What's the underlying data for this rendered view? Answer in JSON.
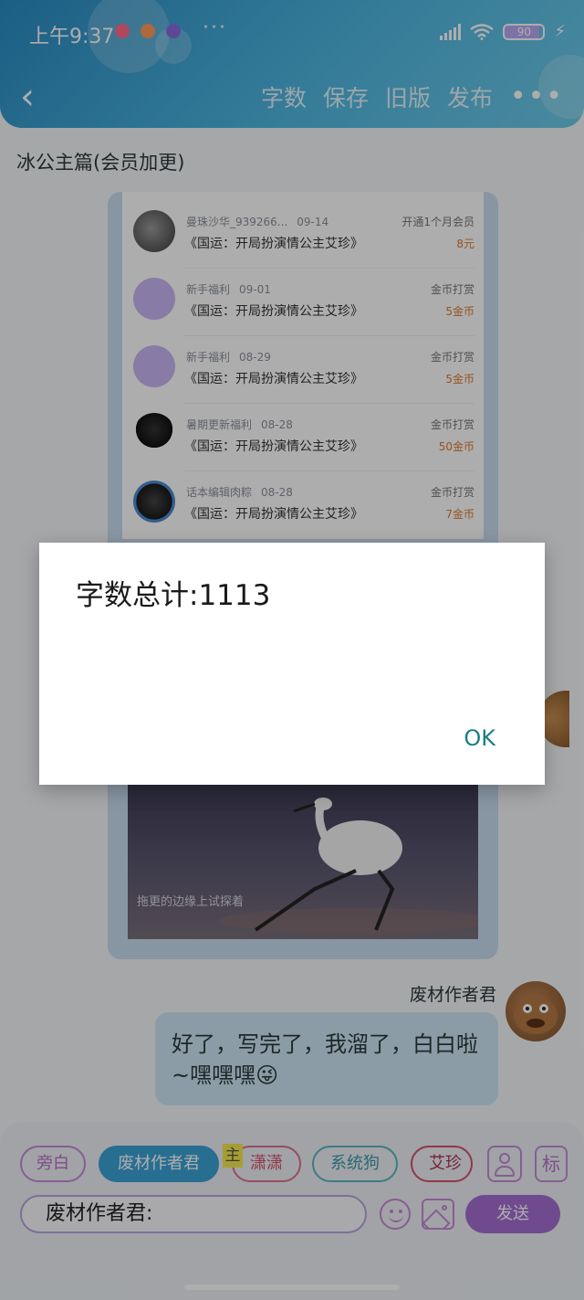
{
  "status": {
    "time": "上午9:37",
    "more": "···",
    "battery": "90"
  },
  "header": {
    "back": "‹",
    "toolbar": [
      "字数",
      "保存",
      "旧版",
      "发布"
    ],
    "more": "•••"
  },
  "chapter_title": "冰公主篇(会员加更)",
  "support_list": [
    {
      "user": "曼珠沙华_939266...",
      "date": "09-14",
      "book": "《国运：开局扮演情公主艾珍》",
      "kind": "开通1个月会员",
      "amount": "8元",
      "avatar_color": "#5a5a5a"
    },
    {
      "user": "新手福利",
      "date": "09-01",
      "book": "《国运：开局扮演情公主艾珍》",
      "kind": "金币打赏",
      "amount": "5金币",
      "avatar_color": "#b69cf0"
    },
    {
      "user": "新手福利",
      "date": "08-29",
      "book": "《国运：开局扮演情公主艾珍》",
      "kind": "金币打赏",
      "amount": "5金币",
      "avatar_color": "#b69cf0"
    },
    {
      "user": "暑期更新福利",
      "date": "08-28",
      "book": "《国运：开局扮演情公主艾珍》",
      "kind": "金币打赏",
      "amount": "50金币",
      "avatar_color": "#1a1a1a"
    },
    {
      "user": "话本编辑肉粽",
      "date": "08-28",
      "book": "《国运：开局扮演情公主艾珍》",
      "kind": "金币打赏",
      "amount": "7金币",
      "avatar_color": "#222222"
    }
  ],
  "image_caption": "拖更的边缘上试探着",
  "message": {
    "author": "废材作者君",
    "text": "好了，写完了，我溜了，白白啦~嘿嘿嘿😜"
  },
  "roles": {
    "narration": "旁白",
    "author": "废材作者君",
    "host_tag": "主",
    "xiaoxiao": "潇潇",
    "system_dog": "系统狗",
    "aizhen": "艾珍~"
  },
  "mark_btn": "标",
  "composer": {
    "value": "废材作者君:",
    "send": "发送"
  },
  "dialog": {
    "title": "字数总计:1113",
    "ok": "OK"
  }
}
